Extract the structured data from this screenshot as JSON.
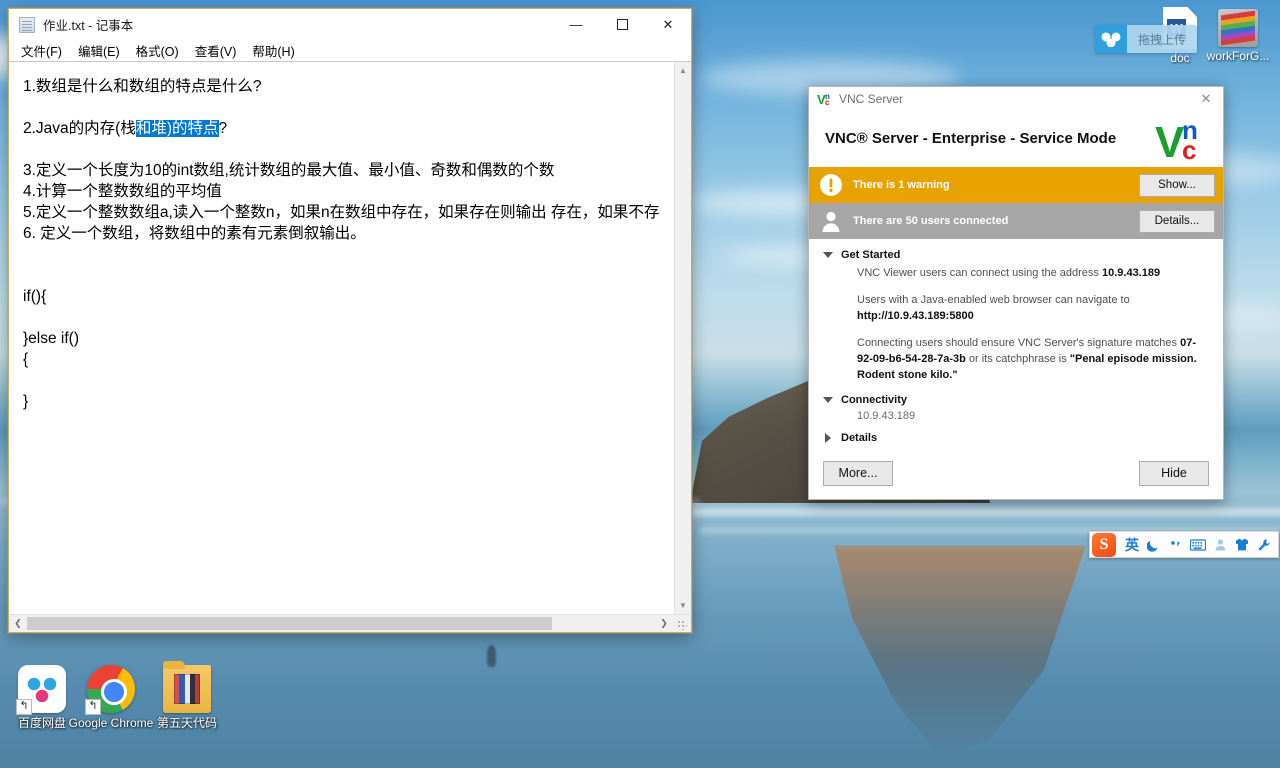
{
  "desktop": {
    "icons": [
      {
        "label": "百度网盘",
        "icon": "baidu-netdisk-icon"
      },
      {
        "label": "Google Chrome",
        "icon": "google-chrome-icon"
      },
      {
        "label": "第五天代码",
        "icon": "folder-icon"
      }
    ],
    "top_icons": [
      {
        "label": "doc",
        "icon": "word-document-icon"
      },
      {
        "label": "workForG...",
        "icon": "winrar-archive-icon"
      }
    ],
    "upload_widget": {
      "label": "拖拽上传",
      "icon": "baidu-cloud-icon"
    }
  },
  "notepad": {
    "title": "作业.txt - 记事本",
    "title_icon": "notepad-icon",
    "window_buttons": {
      "minimize": "—",
      "maximize": "❐",
      "close": "✕"
    },
    "menu": [
      "文件(F)",
      "编辑(E)",
      "格式(O)",
      "查看(V)",
      "帮助(H)"
    ],
    "text": {
      "line1": "1.数组是什么和数组的特点是什么?",
      "line2_pre": "2.Java的内存(栈",
      "line2_selected": "和堆)的特点",
      "line2_post": "?",
      "line3": "",
      "line4": "3.定义一个长度为10的int数组,统计数组的最大值、最小值、奇数和偶数的个数",
      "line5": "4.计算一个整数数组的平均值",
      "line6": "5.定义一个整数数组a,读入一个整数n，如果n在数组中存在，如果存在则输出 存在，如果不存",
      "line7": "6. 定义一个数组，将数组中的素有元素倒叙输出。",
      "line8": "",
      "line9": "",
      "line10": "if(){",
      "line11": "",
      "line12": "}else if()",
      "line13": "{",
      "line14": "",
      "line15": "}"
    },
    "selection_color": "#0078d7"
  },
  "vnc": {
    "window_title": "VNC Server",
    "close_label": "✕",
    "header_title": "VNC® Server - Enterprise - Service Mode",
    "logo_letters": {
      "v": "V",
      "n": "n",
      "c": "c"
    },
    "logo_colors": {
      "v": "#1a9e2e",
      "n": "#1357c8",
      "c": "#e02020"
    },
    "warning_bar": {
      "text": "There is 1 warning",
      "button": "Show...",
      "color": "#e8a200",
      "icon": "warning-exclamation-icon"
    },
    "users_bar": {
      "text": "There are 50 users connected",
      "button": "Details...",
      "color": "#a6a6a6",
      "icon": "user-person-icon"
    },
    "get_started": {
      "heading": "Get Started",
      "line1_pre": "VNC Viewer users can connect using the address ",
      "line1_bold": "10.9.43.189",
      "line2_pre": "Users with a Java-enabled web browser can navigate to ",
      "line2_bold": "http://10.9.43.189:5800",
      "line3_pre": "Connecting users should ensure VNC Server's signature matches ",
      "line3_bold1": "07-92-09-b6-54-28-7a-3b",
      "line3_mid": " or its catchphrase is ",
      "line3_bold2": "\"Penal episode mission. Rodent stone kilo.\""
    },
    "connectivity": {
      "heading": "Connectivity",
      "address": "10.9.43.189"
    },
    "details": {
      "heading": "Details"
    },
    "footer": {
      "more": "More...",
      "hide": "Hide"
    }
  },
  "ime": {
    "logo": "S",
    "items": [
      {
        "glyph": "英",
        "name": "language-mode-icon"
      },
      {
        "glyph": "☽",
        "name": "moon-icon"
      },
      {
        "glyph": "，",
        "name": "punctuation-icon"
      },
      {
        "glyph": "⌨",
        "name": "soft-keyboard-icon"
      },
      {
        "glyph": "👤",
        "name": "user-icon"
      },
      {
        "glyph": "👕",
        "name": "skin-icon"
      },
      {
        "glyph": "🔧",
        "name": "toolbox-icon"
      }
    ]
  }
}
